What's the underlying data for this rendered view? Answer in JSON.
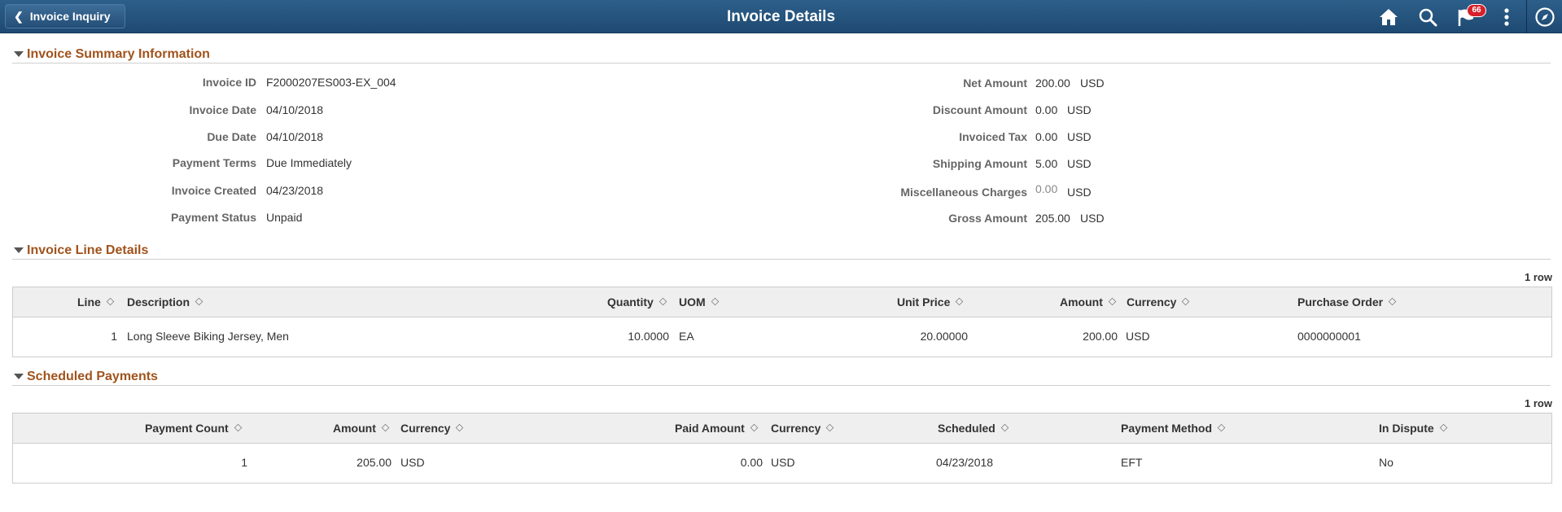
{
  "header": {
    "back_label": "Invoice Inquiry",
    "title": "Invoice Details",
    "notification_count": "66",
    "icons": [
      "home-icon",
      "search-icon",
      "notification-flag-icon",
      "more-options-icon",
      "navbar-compass-icon"
    ]
  },
  "summary": {
    "section_title": "Invoice Summary Information",
    "left_fields": [
      {
        "label": "Invoice ID",
        "value": "F2000207ES003-EX_004"
      },
      {
        "label": "Invoice Date",
        "value": "04/10/2018"
      },
      {
        "label": "Due Date",
        "value": "04/10/2018"
      },
      {
        "label": "Payment Terms",
        "value": "Due Immediately"
      },
      {
        "label": "Invoice Created",
        "value": "04/23/2018"
      },
      {
        "label": "Payment Status",
        "value": "Unpaid"
      }
    ],
    "right_fields": [
      {
        "label": "Net Amount",
        "value": "200.00",
        "currency": "USD"
      },
      {
        "label": "Discount Amount",
        "value": "0.00",
        "currency": "USD"
      },
      {
        "label": "Invoiced Tax",
        "value": "0.00",
        "currency": "USD"
      },
      {
        "label": "Shipping Amount",
        "value": "5.00",
        "currency": "USD"
      },
      {
        "label": "Miscellaneous Charges",
        "value": "0.00",
        "currency": "USD"
      },
      {
        "label": "Gross Amount",
        "value": "205.00",
        "currency": "USD"
      }
    ]
  },
  "line_details": {
    "section_title": "Invoice Line Details",
    "row_count": "1 row",
    "columns": [
      "Line",
      "Description",
      "Quantity",
      "UOM",
      "Unit Price",
      "Amount",
      "Currency",
      "Purchase Order"
    ],
    "rows": [
      {
        "line": "1",
        "description": "Long Sleeve Biking Jersey, Men",
        "quantity": "10.0000",
        "uom": "EA",
        "unit_price": "20.00000",
        "amount": "200.00",
        "currency": "USD",
        "purchase_order": "0000000001"
      }
    ]
  },
  "scheduled_payments": {
    "section_title": "Scheduled Payments",
    "row_count": "1 row",
    "columns": [
      "Payment Count",
      "Amount",
      "Currency",
      "Paid Amount",
      "Currency",
      "Scheduled",
      "Payment Method",
      "In Dispute"
    ],
    "rows": [
      {
        "payment_count": "1",
        "amount": "205.00",
        "currency": "USD",
        "paid_amount": "0.00",
        "paid_currency": "USD",
        "scheduled": "04/23/2018",
        "payment_method": "EFT",
        "in_dispute": "No"
      }
    ]
  },
  "colors": {
    "header_bg": "#1e4a72",
    "section_title": "#a0531c",
    "grid_header_bg": "#efefef",
    "badge": "#d6202a"
  }
}
